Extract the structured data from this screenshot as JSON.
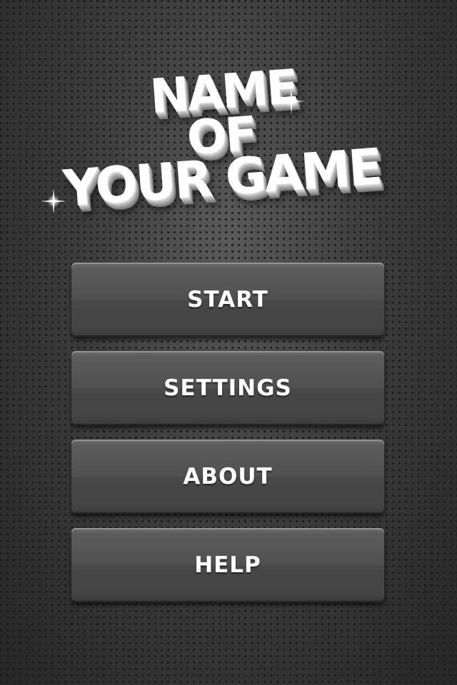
{
  "logo": {
    "line1": "NAME",
    "line2": "OF",
    "line3": "YOUR GAME",
    "text_color": "#ffffff",
    "extrude_color": "#8f8f8f"
  },
  "menu": {
    "buttons": [
      {
        "label": "START"
      },
      {
        "label": "SETTINGS"
      },
      {
        "label": "ABOUT"
      },
      {
        "label": "HELP"
      }
    ]
  },
  "theme": {
    "background": "#3a3a3a",
    "button_color": "#505050",
    "label_color": "#ffffff"
  }
}
